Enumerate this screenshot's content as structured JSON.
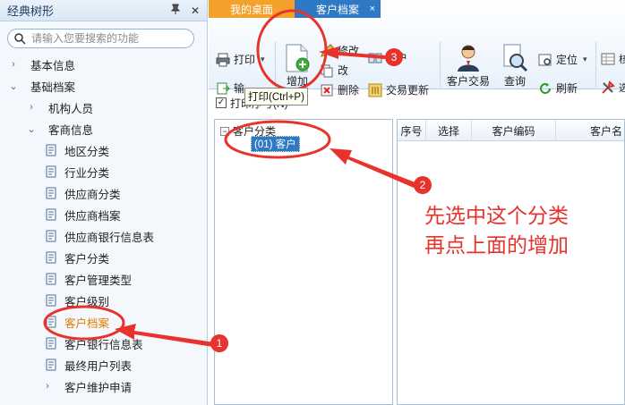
{
  "left_panel": {
    "title": "经典树形",
    "search_placeholder": "请输入您要搜索的功能",
    "items": [
      {
        "label": "基本信息",
        "level": 0,
        "state": "collapsed"
      },
      {
        "label": "基础档案",
        "level": 0,
        "state": "expanded"
      },
      {
        "label": "机构人员",
        "level": 1,
        "state": "collapsed"
      },
      {
        "label": "客商信息",
        "level": 1,
        "state": "expanded"
      },
      {
        "label": "地区分类",
        "level": 2,
        "state": "leaf"
      },
      {
        "label": "行业分类",
        "level": 2,
        "state": "leaf"
      },
      {
        "label": "供应商分类",
        "level": 2,
        "state": "leaf"
      },
      {
        "label": "供应商档案",
        "level": 2,
        "state": "leaf"
      },
      {
        "label": "供应商银行信息表",
        "level": 2,
        "state": "leaf"
      },
      {
        "label": "客户分类",
        "level": 2,
        "state": "leaf"
      },
      {
        "label": "客户管理类型",
        "level": 2,
        "state": "leaf"
      },
      {
        "label": "客户级别",
        "level": 2,
        "state": "leaf"
      },
      {
        "label": "客户档案",
        "level": 2,
        "state": "leaf-selected"
      },
      {
        "label": "客户银行信息表",
        "level": 2,
        "state": "leaf"
      },
      {
        "label": "最终用户列表",
        "level": 2,
        "state": "leaf"
      },
      {
        "label": "客户维护申请",
        "level": 1,
        "state": "collapsed"
      }
    ]
  },
  "tabs": [
    {
      "label": "我的桌面"
    },
    {
      "label": "客户档案",
      "close": "×"
    }
  ],
  "toolbar": {
    "print": "打印",
    "export": "输",
    "add": "增加",
    "modify": "修改",
    "delete_partial": "改",
    "delete": "删除",
    "merge": "并户",
    "trade_update": "交易更新",
    "customer_trade": "客户交易",
    "query": "查询",
    "locate": "定位",
    "refresh": "刷新",
    "tooltip": "打印(Ctrl+P)"
  },
  "print_seq": {
    "label": "打印序号(N)",
    "checked": true
  },
  "category_tree": {
    "root": "客户分类",
    "child": "(01) 客户"
  },
  "grid": {
    "columns": [
      "序号",
      "选择",
      "客户编码",
      "客户名"
    ]
  },
  "annotation": {
    "text_line1": "先选中这个分类",
    "text_line2": "再点上面的增加",
    "badges": [
      "1",
      "2",
      "3"
    ],
    "color": "#e8322c"
  }
}
